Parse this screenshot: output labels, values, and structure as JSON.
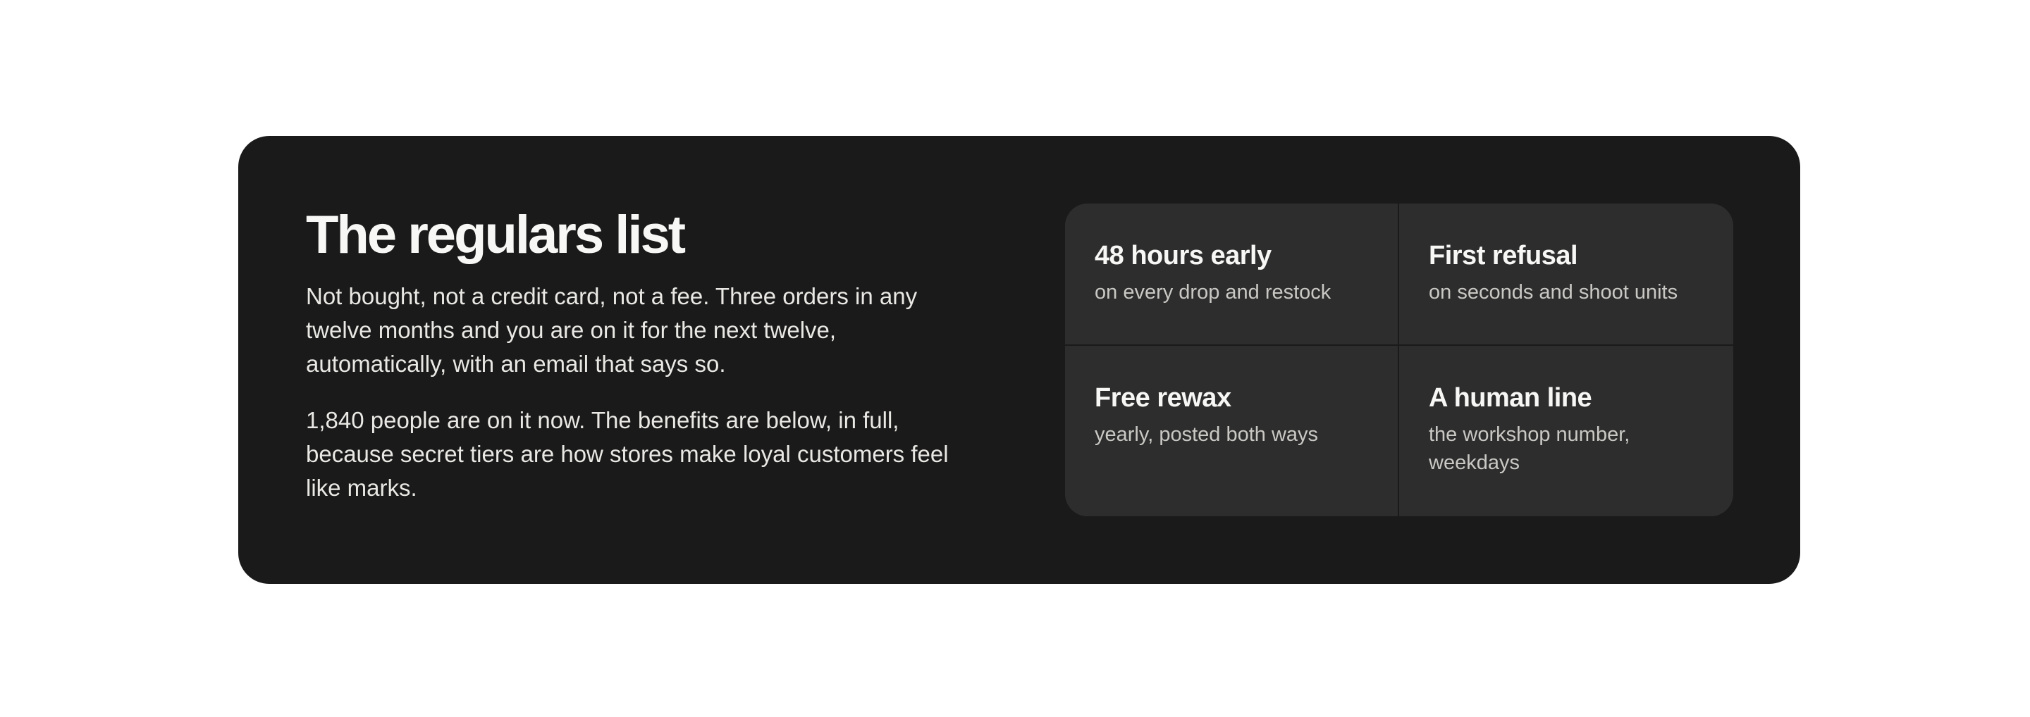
{
  "section": {
    "title": "The regulars list",
    "paragraphs": [
      "Not bought, not a credit card, not a fee. Three orders in any twelve months and you are on it for the next twelve, automatically, with an email that says so.",
      "1,840 people are on it now. The benefits are below, in full, because secret tiers are how stores make loyal customers feel like marks."
    ]
  },
  "benefits": [
    {
      "title": "48 hours early",
      "detail": "on every drop and restock"
    },
    {
      "title": "First refusal",
      "detail": "on seconds and shoot units"
    },
    {
      "title": "Free rewax",
      "detail": "yearly, posted both ways"
    },
    {
      "title": "A human line",
      "detail": "the workshop number, weekdays"
    }
  ],
  "colors": {
    "page_background": "#ffffff",
    "panel_background": "#1a1a1a",
    "tile_background": "#2d2d2d",
    "heading_text": "#f7f7f5",
    "body_text": "#e9e8e4",
    "muted_text": "#c9c8c4"
  }
}
